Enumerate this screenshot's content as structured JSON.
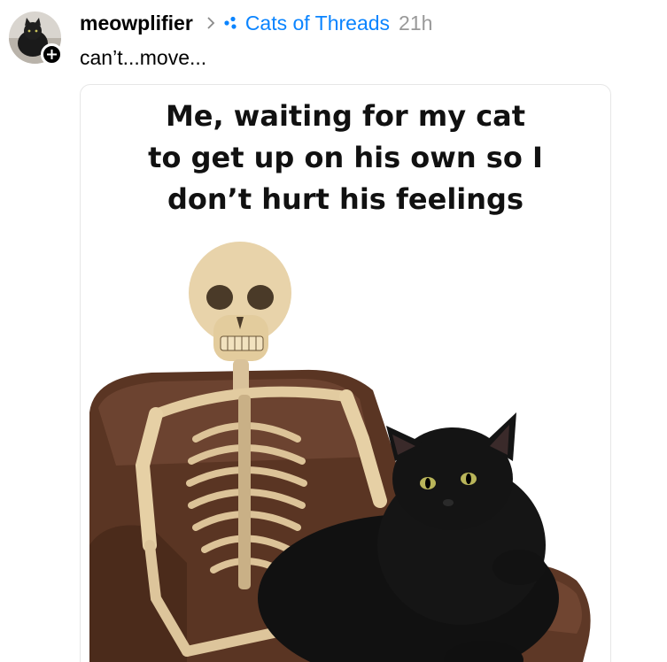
{
  "post": {
    "author": "meowplifier",
    "separator_icon": "chevron-right-icon",
    "community_icon": "community-dots-icon",
    "community": "Cats of Threads",
    "timestamp": "21h",
    "caption": "can’t...move...",
    "follow_icon": "plus-icon"
  },
  "media": {
    "meme_lines": [
      "Me, waiting for my cat",
      "to get up on his own so I",
      "don’t hurt his feelings"
    ]
  },
  "colors": {
    "accent": "#0a84ff",
    "muted": "#999999",
    "text": "#000000"
  }
}
